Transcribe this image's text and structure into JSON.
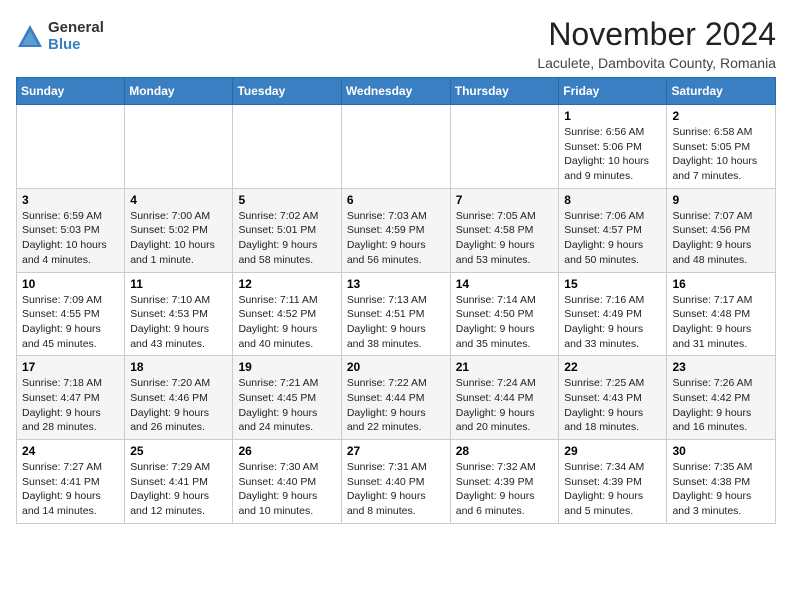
{
  "logo": {
    "general": "General",
    "blue": "Blue"
  },
  "header": {
    "month": "November 2024",
    "location": "Laculete, Dambovita County, Romania"
  },
  "weekdays": [
    "Sunday",
    "Monday",
    "Tuesday",
    "Wednesday",
    "Thursday",
    "Friday",
    "Saturday"
  ],
  "weeks": [
    [
      {
        "day": "",
        "info": ""
      },
      {
        "day": "",
        "info": ""
      },
      {
        "day": "",
        "info": ""
      },
      {
        "day": "",
        "info": ""
      },
      {
        "day": "",
        "info": ""
      },
      {
        "day": "1",
        "info": "Sunrise: 6:56 AM\nSunset: 5:06 PM\nDaylight: 10 hours and 9 minutes."
      },
      {
        "day": "2",
        "info": "Sunrise: 6:58 AM\nSunset: 5:05 PM\nDaylight: 10 hours and 7 minutes."
      }
    ],
    [
      {
        "day": "3",
        "info": "Sunrise: 6:59 AM\nSunset: 5:03 PM\nDaylight: 10 hours and 4 minutes."
      },
      {
        "day": "4",
        "info": "Sunrise: 7:00 AM\nSunset: 5:02 PM\nDaylight: 10 hours and 1 minute."
      },
      {
        "day": "5",
        "info": "Sunrise: 7:02 AM\nSunset: 5:01 PM\nDaylight: 9 hours and 58 minutes."
      },
      {
        "day": "6",
        "info": "Sunrise: 7:03 AM\nSunset: 4:59 PM\nDaylight: 9 hours and 56 minutes."
      },
      {
        "day": "7",
        "info": "Sunrise: 7:05 AM\nSunset: 4:58 PM\nDaylight: 9 hours and 53 minutes."
      },
      {
        "day": "8",
        "info": "Sunrise: 7:06 AM\nSunset: 4:57 PM\nDaylight: 9 hours and 50 minutes."
      },
      {
        "day": "9",
        "info": "Sunrise: 7:07 AM\nSunset: 4:56 PM\nDaylight: 9 hours and 48 minutes."
      }
    ],
    [
      {
        "day": "10",
        "info": "Sunrise: 7:09 AM\nSunset: 4:55 PM\nDaylight: 9 hours and 45 minutes."
      },
      {
        "day": "11",
        "info": "Sunrise: 7:10 AM\nSunset: 4:53 PM\nDaylight: 9 hours and 43 minutes."
      },
      {
        "day": "12",
        "info": "Sunrise: 7:11 AM\nSunset: 4:52 PM\nDaylight: 9 hours and 40 minutes."
      },
      {
        "day": "13",
        "info": "Sunrise: 7:13 AM\nSunset: 4:51 PM\nDaylight: 9 hours and 38 minutes."
      },
      {
        "day": "14",
        "info": "Sunrise: 7:14 AM\nSunset: 4:50 PM\nDaylight: 9 hours and 35 minutes."
      },
      {
        "day": "15",
        "info": "Sunrise: 7:16 AM\nSunset: 4:49 PM\nDaylight: 9 hours and 33 minutes."
      },
      {
        "day": "16",
        "info": "Sunrise: 7:17 AM\nSunset: 4:48 PM\nDaylight: 9 hours and 31 minutes."
      }
    ],
    [
      {
        "day": "17",
        "info": "Sunrise: 7:18 AM\nSunset: 4:47 PM\nDaylight: 9 hours and 28 minutes."
      },
      {
        "day": "18",
        "info": "Sunrise: 7:20 AM\nSunset: 4:46 PM\nDaylight: 9 hours and 26 minutes."
      },
      {
        "day": "19",
        "info": "Sunrise: 7:21 AM\nSunset: 4:45 PM\nDaylight: 9 hours and 24 minutes."
      },
      {
        "day": "20",
        "info": "Sunrise: 7:22 AM\nSunset: 4:44 PM\nDaylight: 9 hours and 22 minutes."
      },
      {
        "day": "21",
        "info": "Sunrise: 7:24 AM\nSunset: 4:44 PM\nDaylight: 9 hours and 20 minutes."
      },
      {
        "day": "22",
        "info": "Sunrise: 7:25 AM\nSunset: 4:43 PM\nDaylight: 9 hours and 18 minutes."
      },
      {
        "day": "23",
        "info": "Sunrise: 7:26 AM\nSunset: 4:42 PM\nDaylight: 9 hours and 16 minutes."
      }
    ],
    [
      {
        "day": "24",
        "info": "Sunrise: 7:27 AM\nSunset: 4:41 PM\nDaylight: 9 hours and 14 minutes."
      },
      {
        "day": "25",
        "info": "Sunrise: 7:29 AM\nSunset: 4:41 PM\nDaylight: 9 hours and 12 minutes."
      },
      {
        "day": "26",
        "info": "Sunrise: 7:30 AM\nSunset: 4:40 PM\nDaylight: 9 hours and 10 minutes."
      },
      {
        "day": "27",
        "info": "Sunrise: 7:31 AM\nSunset: 4:40 PM\nDaylight: 9 hours and 8 minutes."
      },
      {
        "day": "28",
        "info": "Sunrise: 7:32 AM\nSunset: 4:39 PM\nDaylight: 9 hours and 6 minutes."
      },
      {
        "day": "29",
        "info": "Sunrise: 7:34 AM\nSunset: 4:39 PM\nDaylight: 9 hours and 5 minutes."
      },
      {
        "day": "30",
        "info": "Sunrise: 7:35 AM\nSunset: 4:38 PM\nDaylight: 9 hours and 3 minutes."
      }
    ]
  ]
}
